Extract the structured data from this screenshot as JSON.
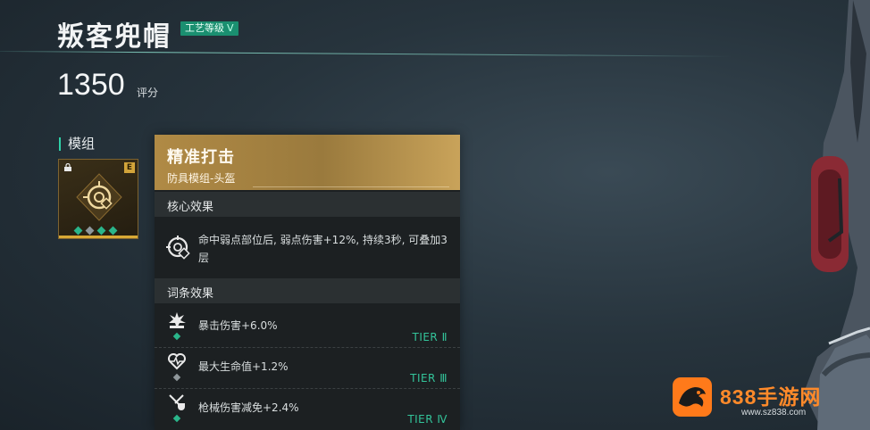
{
  "header": {
    "title": "叛客兜帽",
    "craft_label": "工艺等级",
    "craft_level": "V",
    "score": "1350",
    "score_unit": "评分"
  },
  "module_section": {
    "label": "模组",
    "rank_letter": "E"
  },
  "tooltip": {
    "name": "精准打击",
    "type": "防具模组-头盔",
    "core_heading": "核心效果",
    "core_text": "命中弱点部位后, 弱点伤害+12%, 持续3秒, 可叠加3层",
    "affix_heading": "词条效果",
    "affixes": [
      {
        "text": "暴击伤害+6.0%",
        "tier": "TIER Ⅱ",
        "icon": "burst-icon"
      },
      {
        "text": "最大生命值+1.2%",
        "tier": "TIER Ⅲ",
        "icon": "heart-pulse-icon"
      },
      {
        "text": "枪械伤害减免+2.4%",
        "tier": "TIER Ⅳ",
        "icon": "shield-bullet-icon"
      }
    ]
  },
  "watermark": {
    "brand": "838手游网",
    "url": "www.sz838.com"
  },
  "colors": {
    "accent_teal": "#2ab58a",
    "gold": "#b08a45",
    "watermark_orange": "#ff8a2a"
  }
}
